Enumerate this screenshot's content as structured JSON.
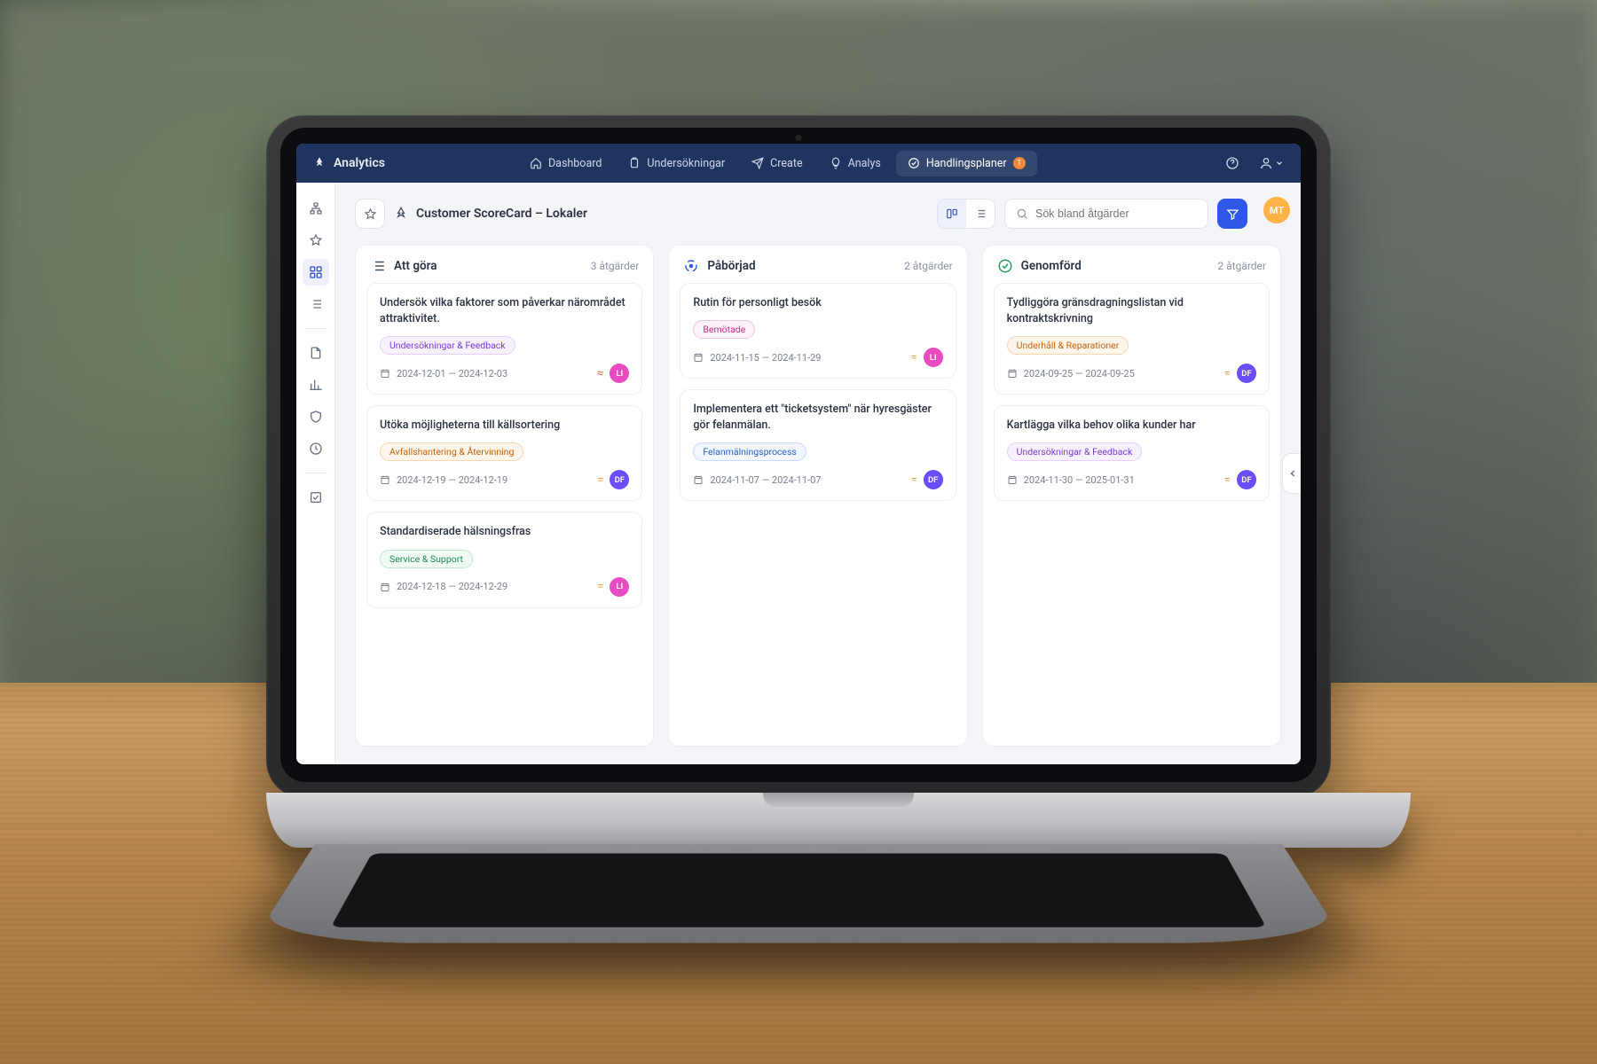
{
  "brand": "Analytics",
  "topnav": [
    {
      "label": "Dashboard"
    },
    {
      "label": "Undersökningar"
    },
    {
      "label": "Create"
    },
    {
      "label": "Analys"
    },
    {
      "label": "Handlingsplaner",
      "badge": "1"
    }
  ],
  "user_avatar": "MT",
  "page_title": "Customer ScoreCard – Lokaler",
  "search_placeholder": "Sök bland åtgärder",
  "columns": [
    {
      "icon": "list",
      "title": "Att göra",
      "count": "3 åtgärder",
      "cards": [
        {
          "title": "Undersök vilka faktorer som påverkar närområdet attraktivitet.",
          "tag_text": "Undersökningar & Feedback",
          "tag_class": "purple",
          "dates": "2024-12-01 — 2024-12-03",
          "prio_glyph": "≈",
          "prio_color": "#e8633a",
          "assignee": "LI",
          "assignee_class": "li"
        },
        {
          "title": "Utöka möjligheterna till källsortering",
          "tag_text": "Avfallshantering & Återvinning",
          "tag_class": "orange",
          "dates": "2024-12-19 — 2024-12-19",
          "prio_glyph": "=",
          "prio_color": "#f0a53c",
          "assignee": "DF",
          "assignee_class": "df"
        },
        {
          "title": "Standardiserade hälsningsfras",
          "tag_text": "Service & Support",
          "tag_class": "green",
          "dates": "2024-12-18 — 2024-12-29",
          "prio_glyph": "=",
          "prio_color": "#f0a53c",
          "assignee": "LI",
          "assignee_class": "li"
        }
      ]
    },
    {
      "icon": "progress",
      "title": "Påbörjad",
      "count": "2 åtgärder",
      "cards": [
        {
          "title": "Rutin för personligt besök",
          "tag_text": "Bemötade",
          "tag_class": "pink",
          "dates": "2024-11-15 — 2024-11-29",
          "prio_glyph": "=",
          "prio_color": "#f0a53c",
          "assignee": "LI",
          "assignee_class": "li"
        },
        {
          "title": "Implementera ett \"ticketsystem\" när hyresgäster gör felanmälan.",
          "tag_text": "Felanmälningsprocess",
          "tag_class": "blue",
          "dates": "2024-11-07 — 2024-11-07",
          "prio_glyph": "=",
          "prio_color": "#f0a53c",
          "assignee": "DF",
          "assignee_class": "df"
        }
      ]
    },
    {
      "icon": "done",
      "title": "Genomförd",
      "count": "2 åtgärder",
      "cards": [
        {
          "title": "Tydliggöra gränsdragningslistan vid kontraktskrivning",
          "tag_text": "Underhåll & Reparationer",
          "tag_class": "orange",
          "dates": "2024-09-25 — 2024-09-25",
          "prio_glyph": "=",
          "prio_color": "#f0a53c",
          "assignee": "DF",
          "assignee_class": "df"
        },
        {
          "title": "Kartlägga vilka behov olika kunder har",
          "tag_text": "Undersökningar & Feedback",
          "tag_class": "purple",
          "dates": "2024-11-30 — 2025-01-31",
          "prio_glyph": "=",
          "prio_color": "#f0a53c",
          "assignee": "DF",
          "assignee_class": "df"
        }
      ]
    }
  ]
}
